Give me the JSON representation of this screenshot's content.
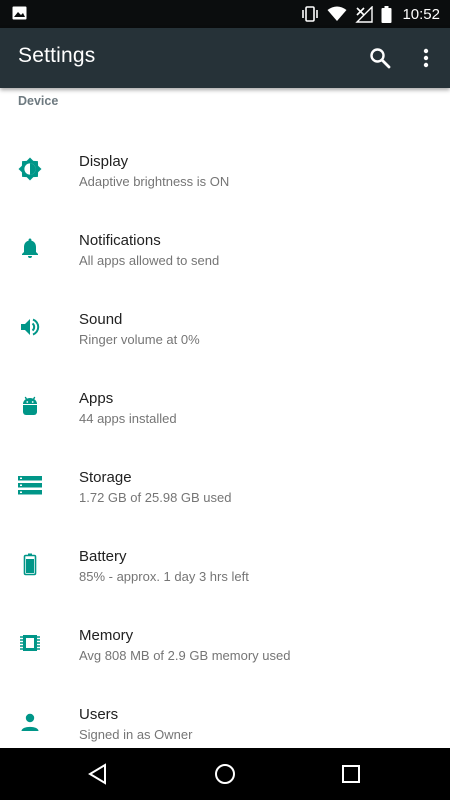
{
  "status_bar": {
    "time": "10:52",
    "icons": [
      "image-icon",
      "vibrate-icon",
      "wifi-icon",
      "signal-off-icon",
      "battery-icon"
    ]
  },
  "app_bar": {
    "title": "Settings",
    "actions": [
      "search-icon",
      "more-vert-icon"
    ]
  },
  "section": {
    "header": "Device"
  },
  "items": [
    {
      "title": "Display",
      "summary": "Adaptive brightness is ON",
      "icon": "brightness-icon"
    },
    {
      "title": "Notifications",
      "summary": "All apps allowed to send",
      "icon": "bell-icon"
    },
    {
      "title": "Sound",
      "summary": "Ringer volume at 0%",
      "icon": "volume-icon"
    },
    {
      "title": "Apps",
      "summary": "44 apps installed",
      "icon": "android-icon"
    },
    {
      "title": "Storage",
      "summary": "1.72 GB of 25.98 GB used",
      "icon": "storage-icon"
    },
    {
      "title": "Battery",
      "summary": "85% - approx. 1 day 3 hrs left",
      "icon": "battery-icon"
    },
    {
      "title": "Memory",
      "summary": "Avg 808 MB of 2.9 GB memory used",
      "icon": "memory-chip-icon"
    },
    {
      "title": "Users",
      "summary": "Signed in as Owner",
      "icon": "person-icon"
    }
  ],
  "colors": {
    "accent": "#009688",
    "app_bar": "#263238",
    "status_bar": "#0b0d0e",
    "nav_bar": "#000000"
  },
  "nav_bar": {
    "buttons": [
      "back-icon",
      "home-icon",
      "recents-icon"
    ]
  }
}
